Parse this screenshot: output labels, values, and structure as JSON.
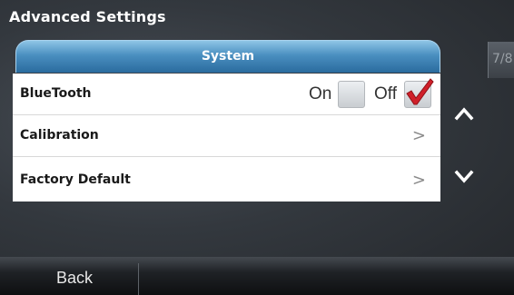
{
  "window": {
    "title": "Advanced Settings"
  },
  "pagination": {
    "indicator": "7/8"
  },
  "section": {
    "title": "System"
  },
  "settings": [
    {
      "label": "BlueTooth",
      "on_label": "On",
      "off_label": "Off",
      "selected": "Off"
    },
    {
      "label": "Calibration",
      "chevron": ">"
    },
    {
      "label": "Factory Default",
      "chevron": ">"
    }
  ],
  "navigation": {
    "up_icon": "chevron-up-icon",
    "down_icon": "chevron-down-icon"
  },
  "footer": {
    "back_label": "Back"
  },
  "colors": {
    "header_blue": "#4a8fc0",
    "checkmark_red": "#d0202a",
    "panel_white": "#ffffff"
  }
}
